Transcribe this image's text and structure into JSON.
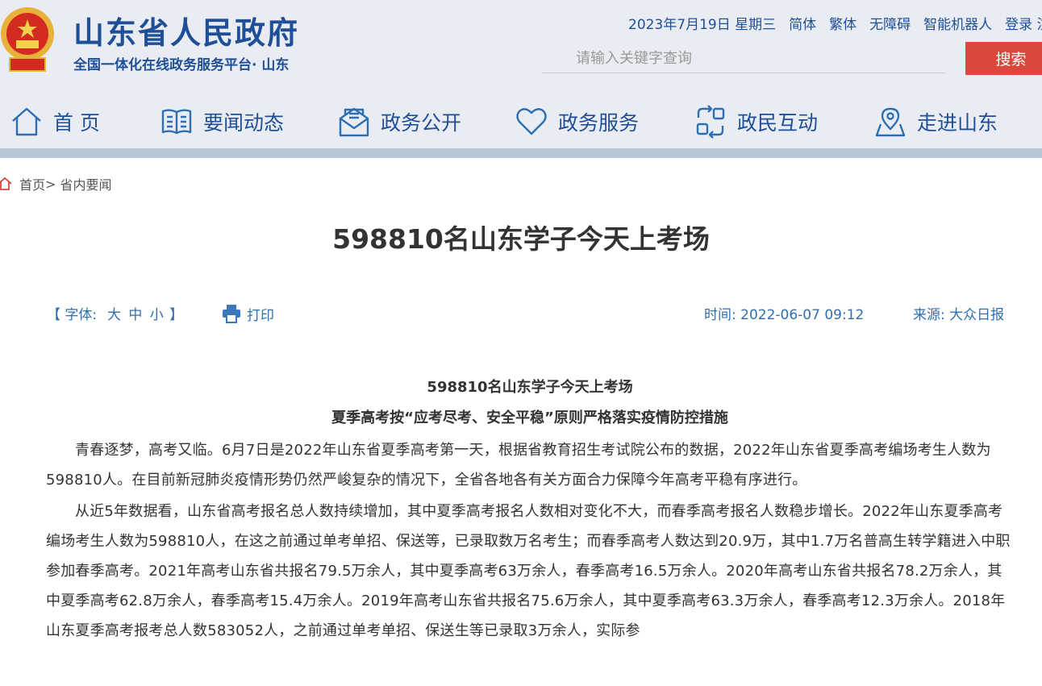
{
  "header": {
    "site_title": "山东省人民政府",
    "site_subtitle": "全国一体化在线政务服务平台· 山东",
    "date": "2023年7月19日 星期三",
    "links": [
      "简体",
      "繁体",
      "无障碍",
      "智能机器人",
      "登录 注"
    ],
    "search_placeholder": "请输入关键字查询",
    "search_button": "搜索"
  },
  "nav": [
    {
      "label": "首 页",
      "icon": "home-icon"
    },
    {
      "label": "要闻动态",
      "icon": "newspaper-icon"
    },
    {
      "label": "政务公开",
      "icon": "mail-open-icon"
    },
    {
      "label": "政务服务",
      "icon": "heart-icon"
    },
    {
      "label": "政民互动",
      "icon": "interaction-icon"
    },
    {
      "label": "走进山东",
      "icon": "location-map-icon"
    }
  ],
  "breadcrumb": {
    "home": "首页",
    "separator": ">",
    "current": "省内要闻"
  },
  "article": {
    "title": "598810名山东学子今天上考场",
    "font_label": "【 字体:",
    "font_sizes": [
      "大",
      "中",
      "小"
    ],
    "font_close": "】",
    "print_label": "打印",
    "time": "时间:  2022-06-07 09:12",
    "source": "来源:  大众日报",
    "subhead1": "598810名山东学子今天上考场",
    "subhead2": "夏季高考按“应考尽考、安全平稳”原则严格落实疫情防控措施",
    "paragraphs": [
      "青春逐梦，高考又临。6月7日是2022年山东省夏季高考第一天，根据省教育招生考试院公布的数据，2022年山东省夏季高考编场考生人数为598810人。在目前新冠肺炎疫情形势仍然严峻复杂的情况下，全省各地各有关方面合力保障今年高考平稳有序进行。",
      "从近5年数据看，山东省高考报名总人数持续增加，其中夏季高考报名人数相对变化不大，而春季高考报名人数稳步增长。2022年山东夏季高考编场考生人数为598810人，在这之前通过单考单招、保送等，已录取数万名考生；而春季高考人数达到20.9万，其中1.7万名普高生转学籍进入中职参加春季高考。2021年高考山东省共报名79.5万余人，其中夏季高考63万余人，春季高考16.5万余人。2020年高考山东省共报名78.2万余人，其中夏季高考62.8万余人，春季高考15.4万余人。2019年高考山东省共报名75.6万余人，其中夏季高考63.3万余人，春季高考12.3万余人。2018年山东夏季高考报考总人数583052人，之前通过单考单招、保送生等已录取3万余人，实际参"
    ]
  },
  "colors": {
    "brand_blue": "#1f4f97",
    "accent_red": "#d9473d",
    "link_blue": "#2e6fb2",
    "header_bg": "#e9edf3"
  }
}
